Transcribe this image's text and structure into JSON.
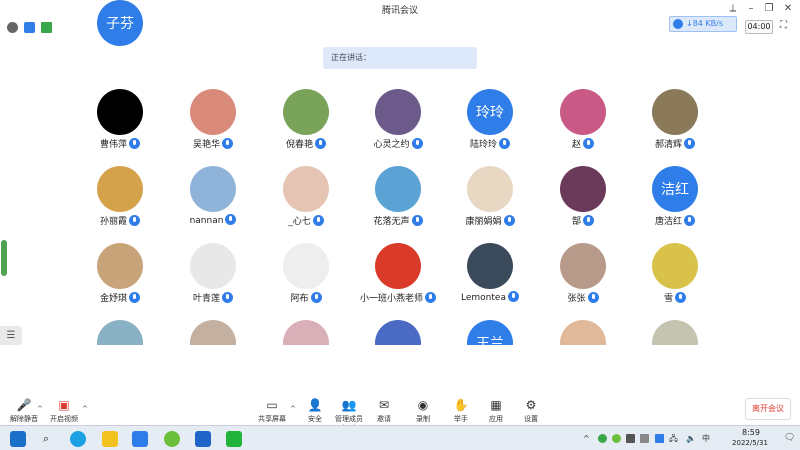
{
  "window": {
    "title": "腾讯会议"
  },
  "infobar": {
    "network_badge": "↓84 KB/s",
    "timer": "04:00"
  },
  "notice": "正在讲话：",
  "participants": [
    {
      "name": "曹伟萍",
      "avatar_text": "",
      "avatar_color": "#000000"
    },
    {
      "name": "吴艳华",
      "avatar_text": "",
      "avatar_color": "#d98a7a"
    },
    {
      "name": "倪春艳",
      "avatar_text": "",
      "avatar_color": "#7aa35a"
    },
    {
      "name": "心灵之约",
      "avatar_text": "",
      "avatar_color": "#6b5a8a"
    },
    {
      "name": "陆玲玲",
      "avatar_text": "玲玲",
      "avatar_color": "#2f7de8"
    },
    {
      "name": "赵",
      "avatar_text": "",
      "avatar_color": "#c95a86"
    },
    {
      "name": "郝清辉",
      "avatar_text": "",
      "avatar_color": "#8a7a5a"
    },
    {
      "name": "孙丽霞",
      "avatar_text": "",
      "avatar_color": "#d4a24a"
    },
    {
      "name": "nannan",
      "avatar_text": "",
      "avatar_color": "#8fb3d9"
    },
    {
      "name": "_心七",
      "avatar_text": "",
      "avatar_color": "#e6c4b4"
    },
    {
      "name": "花落无声",
      "avatar_text": "",
      "avatar_color": "#5aa3d4"
    },
    {
      "name": "康丽娟娟",
      "avatar_text": "",
      "avatar_color": "#e8d7c2"
    },
    {
      "name": "郜",
      "avatar_text": "",
      "avatar_color": "#6b3a5a"
    },
    {
      "name": "唐洁红",
      "avatar_text": "洁红",
      "avatar_color": "#2f7de8"
    },
    {
      "name": "金妤琪",
      "avatar_text": "",
      "avatar_color": "#c9a37a"
    },
    {
      "name": "叶青莲",
      "avatar_text": "",
      "avatar_color": "#e8e8e8"
    },
    {
      "name": "阿布",
      "avatar_text": "",
      "avatar_color": "#eeeeee"
    },
    {
      "name": "小一班小燕老师",
      "avatar_text": "",
      "avatar_color": "#d93a2a"
    },
    {
      "name": "Lemontea",
      "avatar_text": "",
      "avatar_color": "#3a4a5a"
    },
    {
      "name": "张张",
      "avatar_text": "",
      "avatar_color": "#b89a8a"
    },
    {
      "name": "雪",
      "avatar_text": "",
      "avatar_color": "#d9c24a"
    },
    {
      "name": "",
      "avatar_text": "",
      "avatar_color": "#8ab0c4"
    },
    {
      "name": "",
      "avatar_text": "",
      "avatar_color": "#c4b0a0"
    },
    {
      "name": "",
      "avatar_text": "",
      "avatar_color": "#d9b0b8"
    },
    {
      "name": "",
      "avatar_text": "",
      "avatar_color": "#4a6ac4"
    },
    {
      "name": "",
      "avatar_text": "王兰",
      "avatar_color": "#2f7de8"
    },
    {
      "name": "",
      "avatar_text": "",
      "avatar_color": "#e0b89a"
    },
    {
      "name": "",
      "avatar_text": "",
      "avatar_color": "#c4c4b0"
    },
    {
      "name": "",
      "avatar_text": "子芬",
      "avatar_color": "#2f7de8"
    }
  ],
  "toolbar": {
    "mute": "解除静音",
    "video": "开启视频",
    "share": "共享屏幕",
    "members": "管理成员(29)",
    "invite": "邀请",
    "chat": "聊天",
    "record": "录制",
    "raise_hand": "举手",
    "apps": "应用",
    "settings": "设置",
    "end": "离开会议"
  },
  "taskbar": {
    "time": "8:59",
    "date": "2022/5/31"
  },
  "colors": {
    "accent": "#2f7de8",
    "end_red": "#e03c32"
  },
  "icons": [
    "shield-icon",
    "signal-icon",
    "mic-muted-icon",
    "camera-off-icon",
    "share-screen-icon",
    "members-icon",
    "invite-icon",
    "chat-icon",
    "record-icon",
    "hand-icon",
    "apps-icon",
    "gear-icon"
  ]
}
